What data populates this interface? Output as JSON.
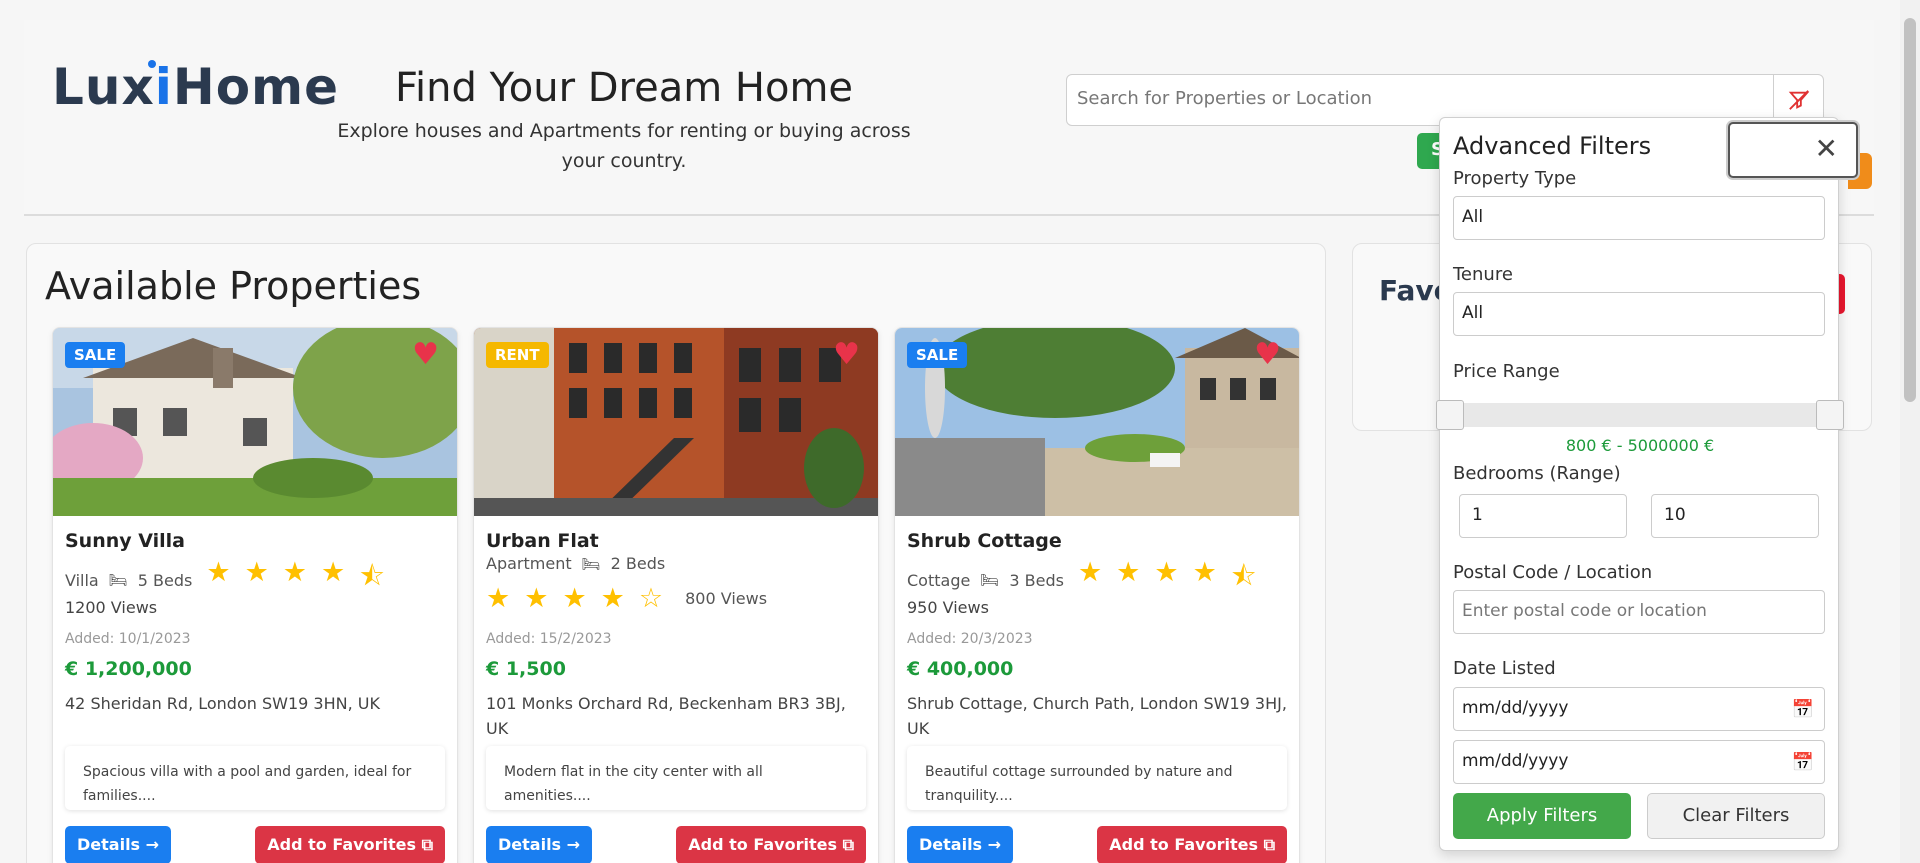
{
  "header": {
    "logo_left": "Lux",
    "logo_mid": "i",
    "logo_right": "Home",
    "title": "Find Your Dream Home",
    "subtitle": "Explore houses and Apartments for renting or buying across your country.",
    "search_placeholder": "Search for Properties or Location",
    "search_button": "Search"
  },
  "properties": {
    "title": "Available Properties",
    "cards": [
      {
        "badge": "SALE",
        "name": "Sunny Villa",
        "type": "Villa",
        "beds": "5 Beds",
        "views": "1200 Views",
        "added": "Added: 10/1/2023",
        "price": "€ 1,200,000",
        "address": "42 Sheridan Rd, London SW19 3HN, UK",
        "description": "Spacious villa with a pool and garden, ideal for families....",
        "rating": 4.5,
        "details_label": "Details →",
        "fav_label": "Add to Favorites"
      },
      {
        "badge": "RENT",
        "name": "Urban Flat",
        "type": "Apartment",
        "beds": "2 Beds",
        "views": "800 Views",
        "added": "Added: 15/2/2023",
        "price": "€ 1,500",
        "address": "101 Monks Orchard Rd, Beckenham BR3 3BJ, UK",
        "description": "Modern flat in the city center with all amenities....",
        "rating": 4,
        "details_label": "Details →",
        "fav_label": "Add to Favorites"
      },
      {
        "badge": "SALE",
        "name": "Shrub Cottage",
        "type": "Cottage",
        "beds": "3 Beds",
        "views": "950 Views",
        "added": "Added: 20/3/2023",
        "price": "€ 400,000",
        "address": "Shrub Cottage, Church Path, London SW19 3HJ, UK",
        "description": "Beautiful cottage surrounded by nature and tranquility....",
        "rating": 4.5,
        "details_label": "Details →",
        "fav_label": "Add to Favorites"
      }
    ]
  },
  "favorites": {
    "title": "Favo"
  },
  "filters": {
    "title": "Advanced Filters",
    "property_type_label": "Property Type",
    "property_type_value": "All",
    "tenure_label": "Tenure",
    "tenure_value": "All",
    "price_label": "Price Range",
    "price_range_text": "800 € - 5000000 €",
    "price_min_fraction": 0,
    "price_max_fraction": 1,
    "bedrooms_label": "Bedrooms (Range)",
    "bedrooms_min": "1",
    "bedrooms_max": "10",
    "postal_label": "Postal Code / Location",
    "postal_placeholder": "Enter postal code or location",
    "date_label": "Date Listed",
    "date_from": "mm/dd/yyyy",
    "date_to": "mm/dd/yyyy",
    "apply_label": "Apply Filters",
    "clear_label": "Clear Filters"
  },
  "colors": {
    "sale_badge": "#1a7ef0",
    "rent_badge": "#f5b800",
    "price": "#1c9a3a",
    "details_button": "#1a7ef0",
    "favorites_button": "#db3545",
    "apply_button": "#43a84a",
    "star": "#ffc000"
  }
}
